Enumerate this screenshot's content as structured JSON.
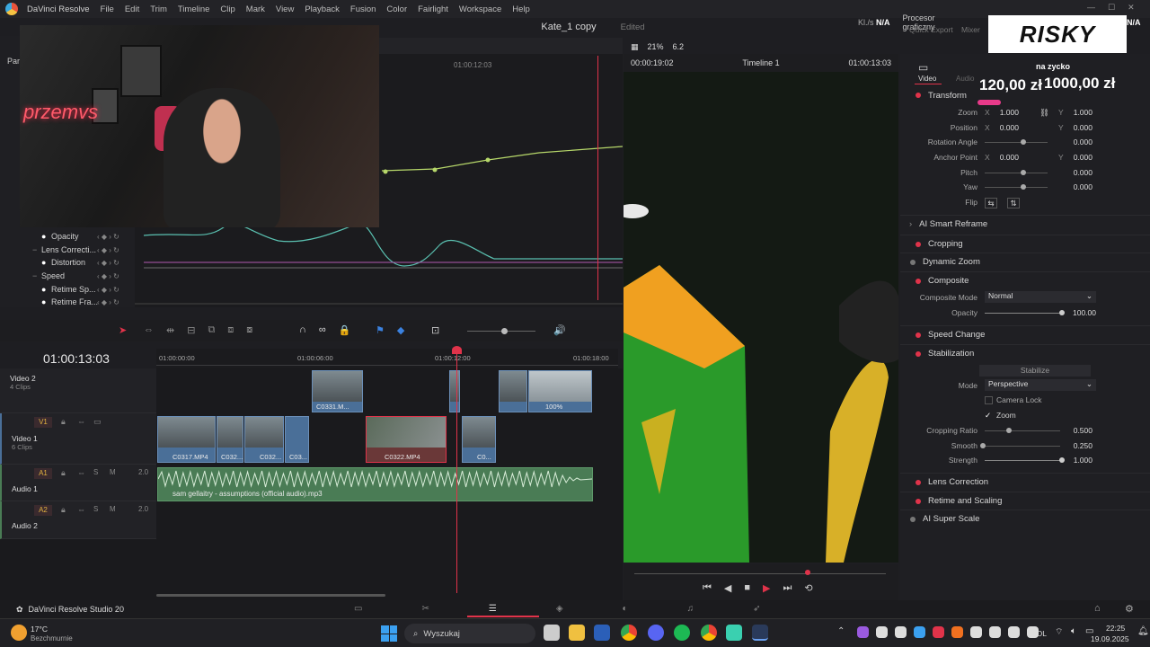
{
  "menubar": {
    "app_name": "DaVinci Resolve",
    "items": [
      "File",
      "Edit",
      "Trim",
      "Timeline",
      "Clip",
      "Mark",
      "View",
      "Playback",
      "Fusion",
      "Color",
      "Fairlight",
      "Workspace",
      "Help"
    ]
  },
  "project": {
    "title": "Kate_1 copy",
    "status": "Edited"
  },
  "topright": {
    "kbs": "Kl./s",
    "na": "N/A",
    "processor": "Procesor graficzny",
    "quick_export": "Quick Export",
    "mixer": "Mixer",
    "clip_name": "C0322.MP4",
    "na2": "N/A"
  },
  "overlay": {
    "risky": "RISKY",
    "na_zycko": "na zycko",
    "amount1": "120,00 zł",
    "amount2": "1000,00 zł",
    "neon_text": "przemvs"
  },
  "viewer": {
    "zoom": "21%",
    "fps": "6.2",
    "timecode_left": "00:00:19:02",
    "timeline_name": "Timeline 1",
    "timecode_right": "01:00:13:03"
  },
  "graph": {
    "ruler_tc": "01:00:12:03"
  },
  "left_params": [
    {
      "label": "Opacity",
      "dot": true
    },
    {
      "label": "Lens Correcti...",
      "dot": false
    },
    {
      "label": "Distortion",
      "dot": true
    },
    {
      "label": "Speed",
      "dot": false
    },
    {
      "label": "Retime Sp...",
      "dot": true
    },
    {
      "label": "Retime Fra...",
      "dot": true
    }
  ],
  "left_stub": "Par",
  "inspector": {
    "tabs": [
      "Video",
      "Audio"
    ],
    "transform": "Transform",
    "zoom_label": "Zoom",
    "zoom_x": "1.000",
    "zoom_y": "1.000",
    "position_label": "Position",
    "pos_x": "0.000",
    "pos_y": "0.000",
    "rotation_label": "Rotation Angle",
    "rotation": "0.000",
    "anchor_label": "Anchor Point",
    "anchor_x": "0.000",
    "anchor_y": "0.000",
    "pitch_label": "Pitch",
    "pitch": "0.000",
    "yaw_label": "Yaw",
    "yaw": "0.000",
    "flip_label": "Flip",
    "ai_reframe": "AI Smart Reframe",
    "cropping": "Cropping",
    "dynamic_zoom": "Dynamic Zoom",
    "composite": "Composite",
    "composite_mode_label": "Composite Mode",
    "composite_mode": "Normal",
    "opacity_label": "Opacity",
    "opacity": "100.00",
    "speed_change": "Speed Change",
    "stabilization": "Stabilization",
    "stabilize_btn": "Stabilize",
    "mode_label": "Mode",
    "mode": "Perspective",
    "camera_lock": "Camera Lock",
    "zoom_check": "Zoom",
    "crop_ratio_label": "Cropping Ratio",
    "crop_ratio": "0.500",
    "smooth_label": "Smooth",
    "smooth": "0.250",
    "strength_label": "Strength",
    "strength": "1.000",
    "lens_correction": "Lens Correction",
    "retime_scaling": "Retime and Scaling",
    "ai_super_scale": "AI Super Scale"
  },
  "timeline": {
    "timecode": "01:00:13:03",
    "ruler": [
      "01:00:00:00",
      "01:00:06:00",
      "01:00:12:00",
      "01:00:18:00"
    ],
    "tracks": {
      "v2": {
        "name": "Video 2",
        "sub": "4 Clips"
      },
      "v1": {
        "id": "V1",
        "name": "Video 1",
        "sub": "6 Clips"
      },
      "a1": {
        "id": "A1",
        "name": "Audio 1",
        "level": "2.0"
      },
      "a2": {
        "id": "A2",
        "name": "Audio 2",
        "level": "2.0"
      }
    },
    "clips": {
      "c0331": "C0331.M...",
      "pct": "100%",
      "c0317": "C0317.MP4",
      "c032a": "C032...",
      "c032b": "C032...",
      "c03": "C03...",
      "c0322": "C0322.MP4",
      "c0": "C0..."
    },
    "audio_clip": "sam gellaitry - assumptions (official audio).mp3"
  },
  "bottombar": {
    "product": "DaVinci Resolve Studio 20"
  },
  "taskbar": {
    "temp": "17°C",
    "weather": "Bezchmurnie",
    "search": "Wyszukaj",
    "lang": "POL",
    "time": "22:25",
    "date": "19.09.2025"
  },
  "colors": {
    "accent": "#e0334a",
    "clip_blue": "#4a6f98",
    "audio_green": "#4a7c55"
  }
}
